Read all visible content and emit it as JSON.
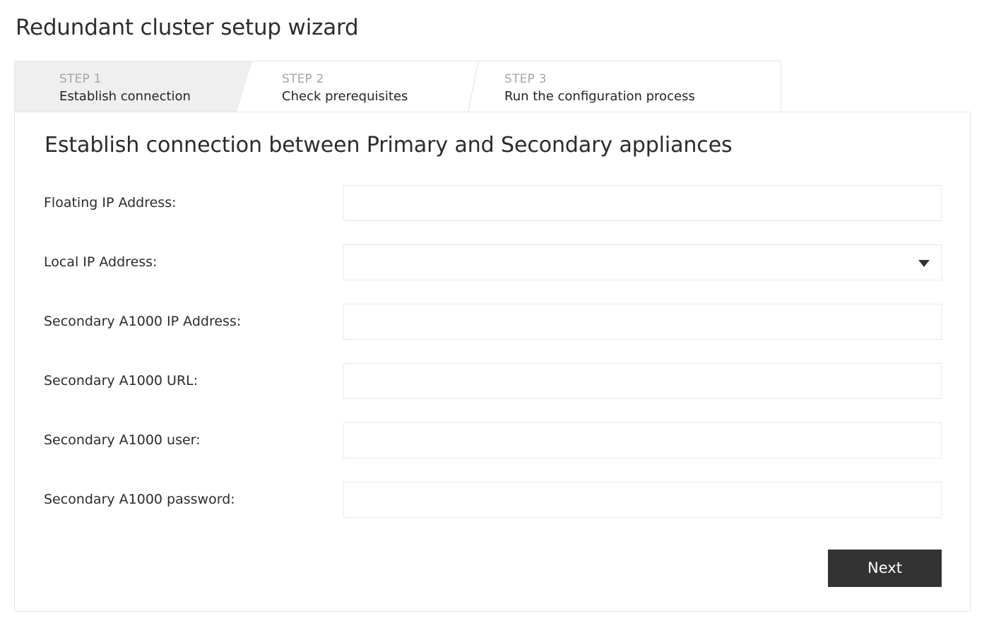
{
  "page": {
    "title": "Redundant cluster setup wizard"
  },
  "wizard": {
    "steps": [
      {
        "step_label": "STEP 1",
        "name": "Establish connection",
        "state": "active"
      },
      {
        "step_label": "STEP 2",
        "name": "Check prerequisites",
        "state": "inactive"
      },
      {
        "step_label": "STEP 3",
        "name": "Run the configuration process",
        "state": "inactive"
      }
    ]
  },
  "panel": {
    "heading": "Establish connection between Primary and Secondary appliances",
    "fields": [
      {
        "label": "Floating IP Address:",
        "type": "text",
        "value": "",
        "placeholder": ""
      },
      {
        "label": "Local IP Address:",
        "type": "select",
        "value": "",
        "placeholder": "",
        "icon": "chevron-down-icon"
      },
      {
        "label": "Secondary A1000 IP Address:",
        "type": "text",
        "value": "",
        "placeholder": ""
      },
      {
        "label": "Secondary A1000 URL:",
        "type": "text",
        "value": "",
        "placeholder": ""
      },
      {
        "label": "Secondary A1000 user:",
        "type": "text",
        "value": "",
        "placeholder": ""
      },
      {
        "label": "Secondary A1000 password:",
        "type": "password",
        "value": "",
        "placeholder": ""
      }
    ],
    "next_label": "Next"
  },
  "colors": {
    "page_background": "#ffffff",
    "active_tab_background": "#efefef",
    "border": "#e6e6e6",
    "field_border": "#e9e9e9",
    "text_primary": "#2b2b2b",
    "text_muted": "#a6a6a6",
    "button_background": "#333333",
    "button_text": "#ffffff"
  }
}
